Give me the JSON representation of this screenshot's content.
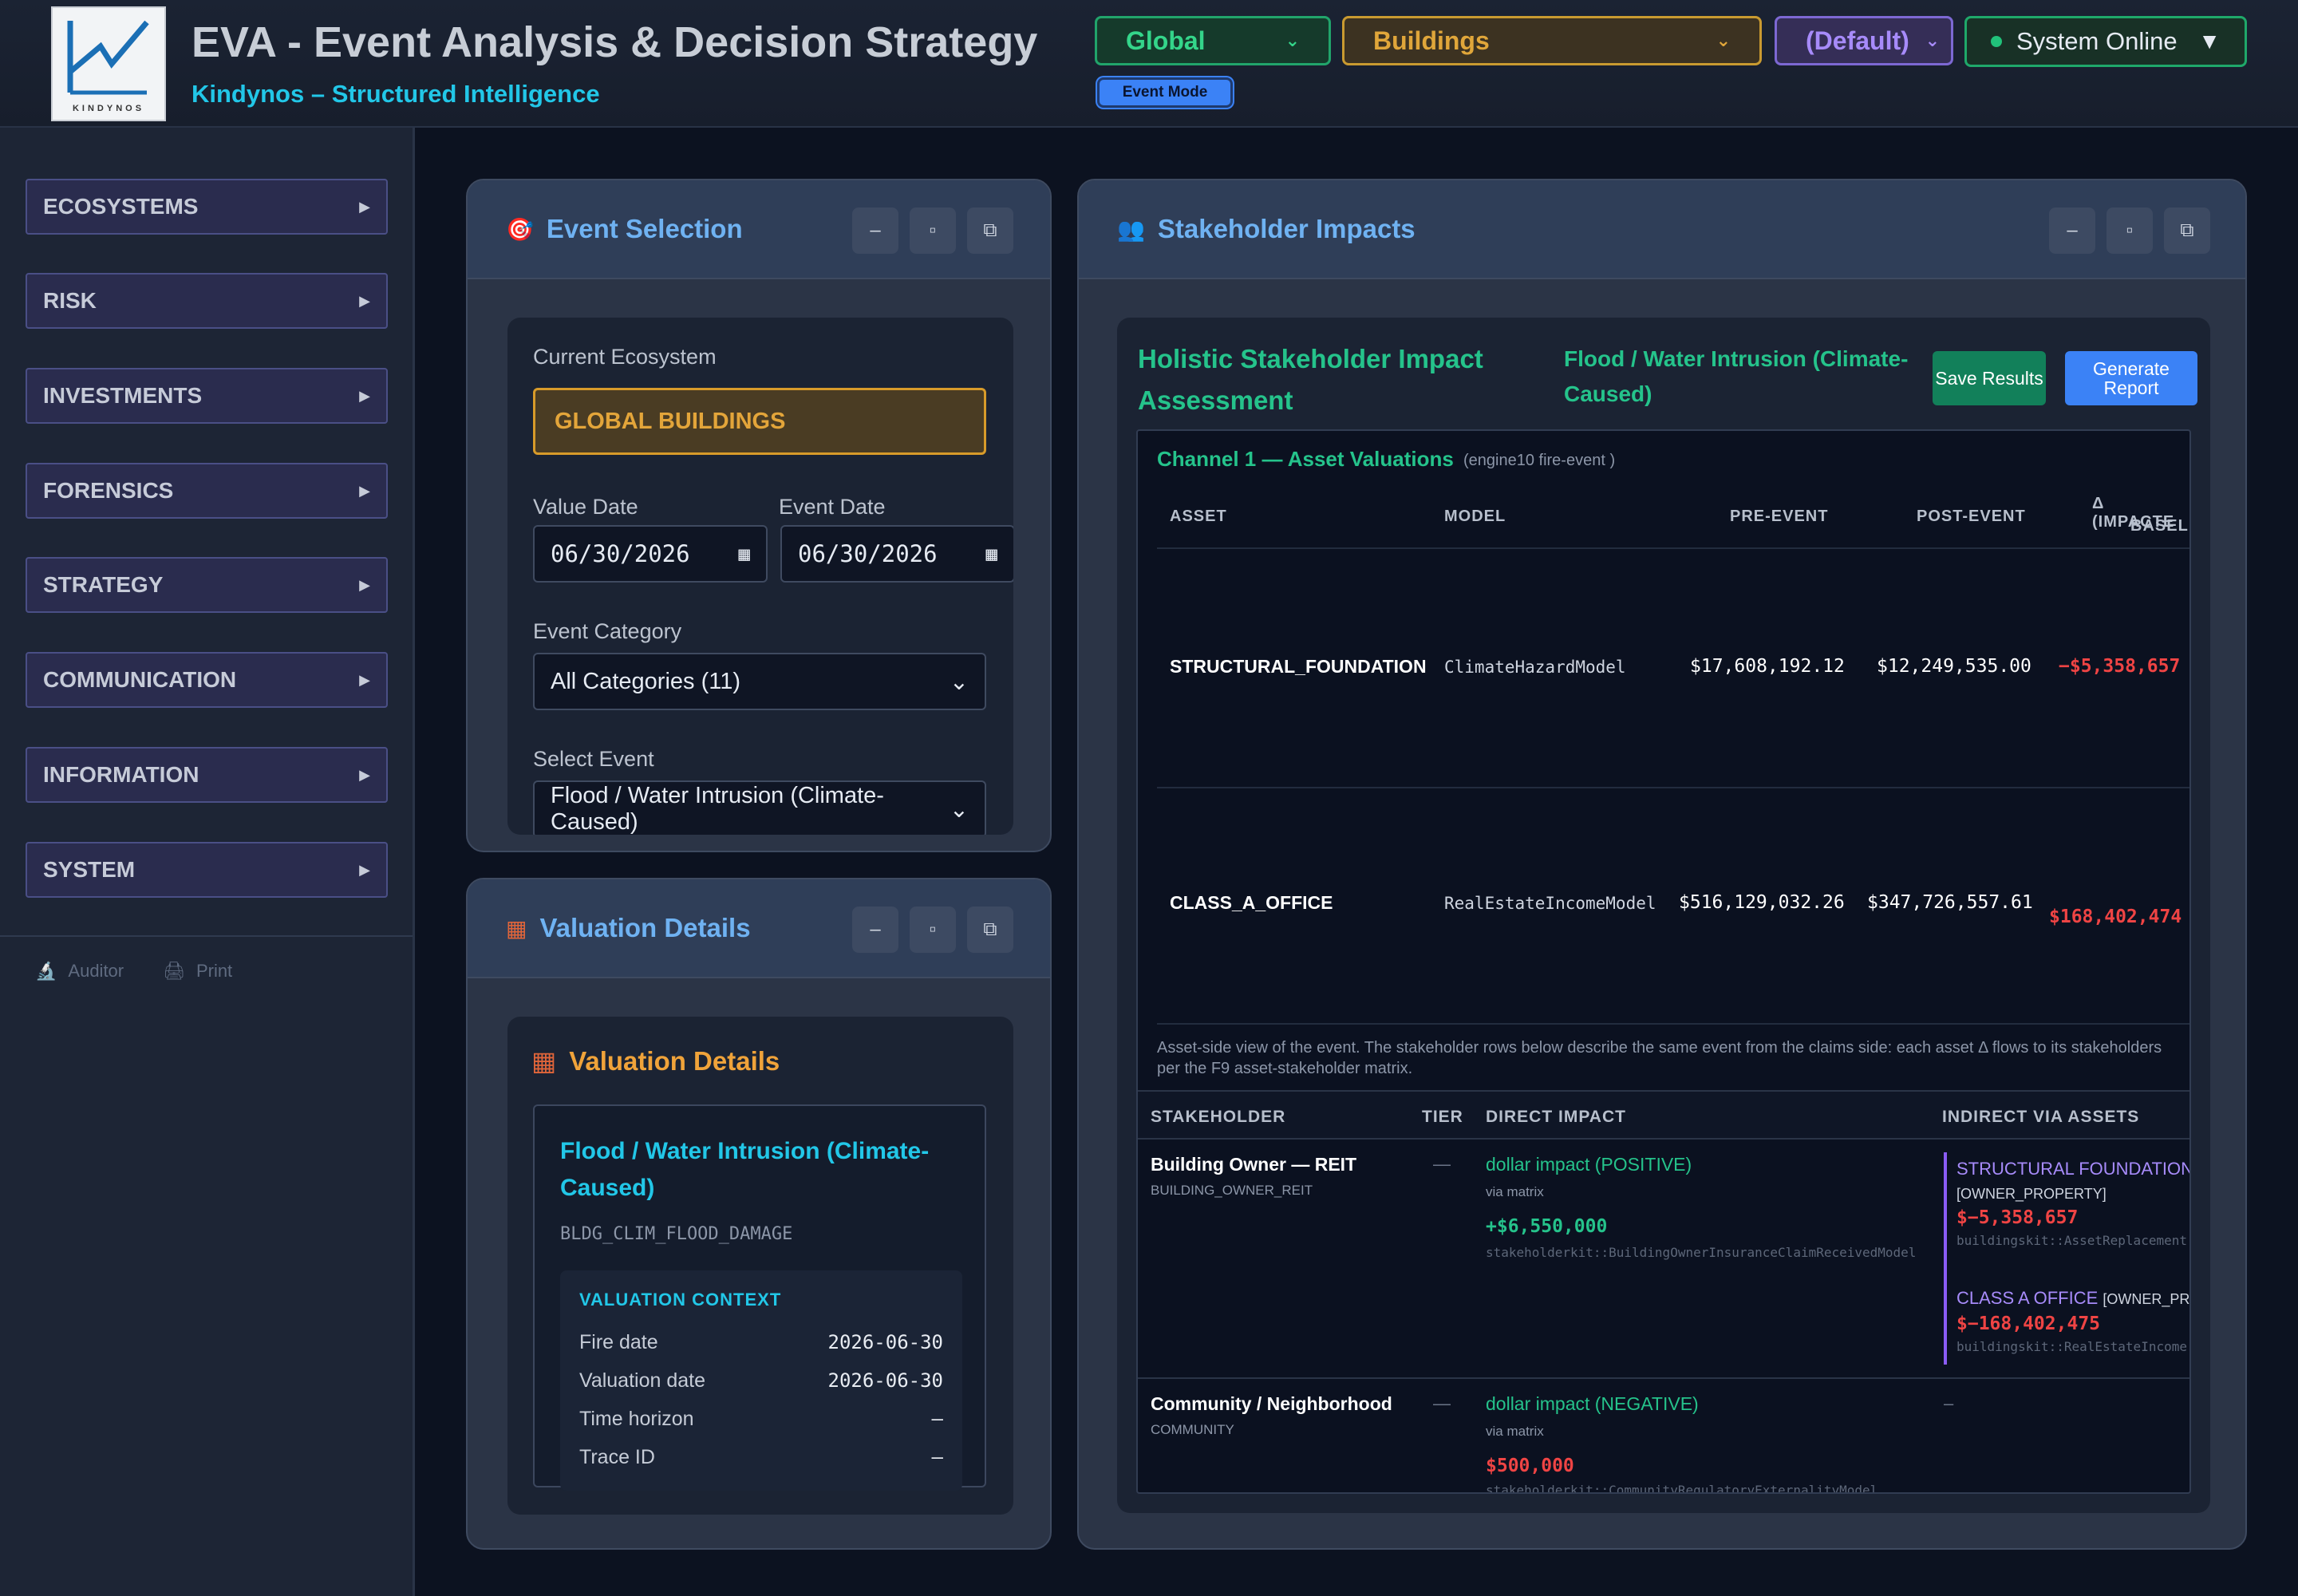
{
  "header": {
    "title": "EVA - Event Analysis & Decision Strategy",
    "subtitle": "Kindynos – Structured Intelligence",
    "logo_text": "KINDYNOS",
    "selects": {
      "scope": "Global",
      "ecosystem": "Buildings",
      "profile": "(Default)"
    },
    "status": "System Online",
    "mode_badge": "Event Mode"
  },
  "sidebar": {
    "items": [
      {
        "label": "ECOSYSTEMS"
      },
      {
        "label": "RISK"
      },
      {
        "label": "INVESTMENTS"
      },
      {
        "label": "FORENSICS"
      },
      {
        "label": "STRATEGY"
      },
      {
        "label": "COMMUNICATION"
      },
      {
        "label": "INFORMATION"
      },
      {
        "label": "SYSTEM"
      }
    ],
    "tools": {
      "auditor": "Auditor",
      "print": "Print"
    }
  },
  "event_selection": {
    "title": "Event Selection",
    "current_ecosystem_label": "Current Ecosystem",
    "current_ecosystem": "GLOBAL BUILDINGS",
    "value_date_label": "Value Date",
    "value_date": "06/30/2026",
    "event_date_label": "Event Date",
    "event_date": "06/30/2026",
    "category_label": "Event Category",
    "category": "All Categories (11)",
    "select_event_label": "Select Event",
    "selected_event": "Flood / Water Intrusion (Climate-Caused)"
  },
  "valuation": {
    "panel_title": "Valuation Details",
    "title": "Valuation Details",
    "event_name": "Flood / Water Intrusion (Climate-Caused)",
    "event_code": "BLDG_CLIM_FLOOD_DAMAGE",
    "context_title": "VALUATION CONTEXT",
    "context": [
      {
        "label": "Fire date",
        "value": "2026-06-30"
      },
      {
        "label": "Valuation date",
        "value": "2026-06-30"
      },
      {
        "label": "Time horizon",
        "value": "—"
      },
      {
        "label": "Trace ID",
        "value": "—"
      }
    ]
  },
  "stakeholder": {
    "panel_title": "Stakeholder Impacts",
    "title": "Holistic Stakeholder Impact Assessment",
    "event": "Flood / Water Intrusion (Climate-Caused)",
    "save_label": "Save Results",
    "report_label": "Generate Report",
    "channel_title": "Channel 1 — Asset Valuations",
    "channel_sub": "(engine10 fire-event )",
    "asset_headers": [
      "ASSET",
      "MODEL",
      "PRE-EVENT",
      "POST-EVENT",
      "Δ (IMPACTE",
      "BASELI"
    ],
    "assets": [
      {
        "name": "STRUCTURAL_FOUNDATION",
        "model": "ClimateHazardModel",
        "pre": "$17,608,192.12",
        "post": "$12,249,535.00",
        "delta": "−$5,358,657"
      },
      {
        "name": "CLASS_A_OFFICE",
        "model": "RealEstateIncomeModel",
        "pre": "$516,129,032.26",
        "post": "$347,726,557.61",
        "delta": "$168,402,474"
      }
    ],
    "note": "Asset-side view of the event. The stakeholder rows below describe the same event from the claims side: each asset Δ flows to its stakeholders per the F9 asset-stakeholder matrix.",
    "sh_headers": [
      "STAKEHOLDER",
      "TIER",
      "DIRECT IMPACT",
      "INDIRECT VIA ASSETS"
    ],
    "rows": [
      {
        "name": "Building Owner — REIT",
        "code": "BUILDING_OWNER_REIT",
        "tier": "—",
        "impact": "dollar impact (POSITIVE)",
        "via": "via matrix",
        "amount": "+$6,550,000",
        "model": "stakeholderkit::BuildingOwnerInsuranceClaimReceivedModel",
        "indirect": [
          {
            "name": "STRUCTURAL FOUNDATION",
            "tag": "[OWNER_PROPERTY]",
            "amount": "$−5,358,657",
            "model": "buildingskit::AssetReplacement"
          },
          {
            "name": "CLASS A OFFICE",
            "tag": "[OWNER_PROF",
            "amount": "$−168,402,475",
            "model": "buildingskit::RealEstateIncome"
          }
        ]
      },
      {
        "name": "Community / Neighborhood",
        "code": "COMMUNITY",
        "tier": "—",
        "impact": "dollar impact (NEGATIVE)",
        "via": "via matrix",
        "amount": "$500,000",
        "model": "stakeholderkit::CommunityRegulatoryExternalityModel",
        "indirect_none": "–"
      }
    ]
  }
}
